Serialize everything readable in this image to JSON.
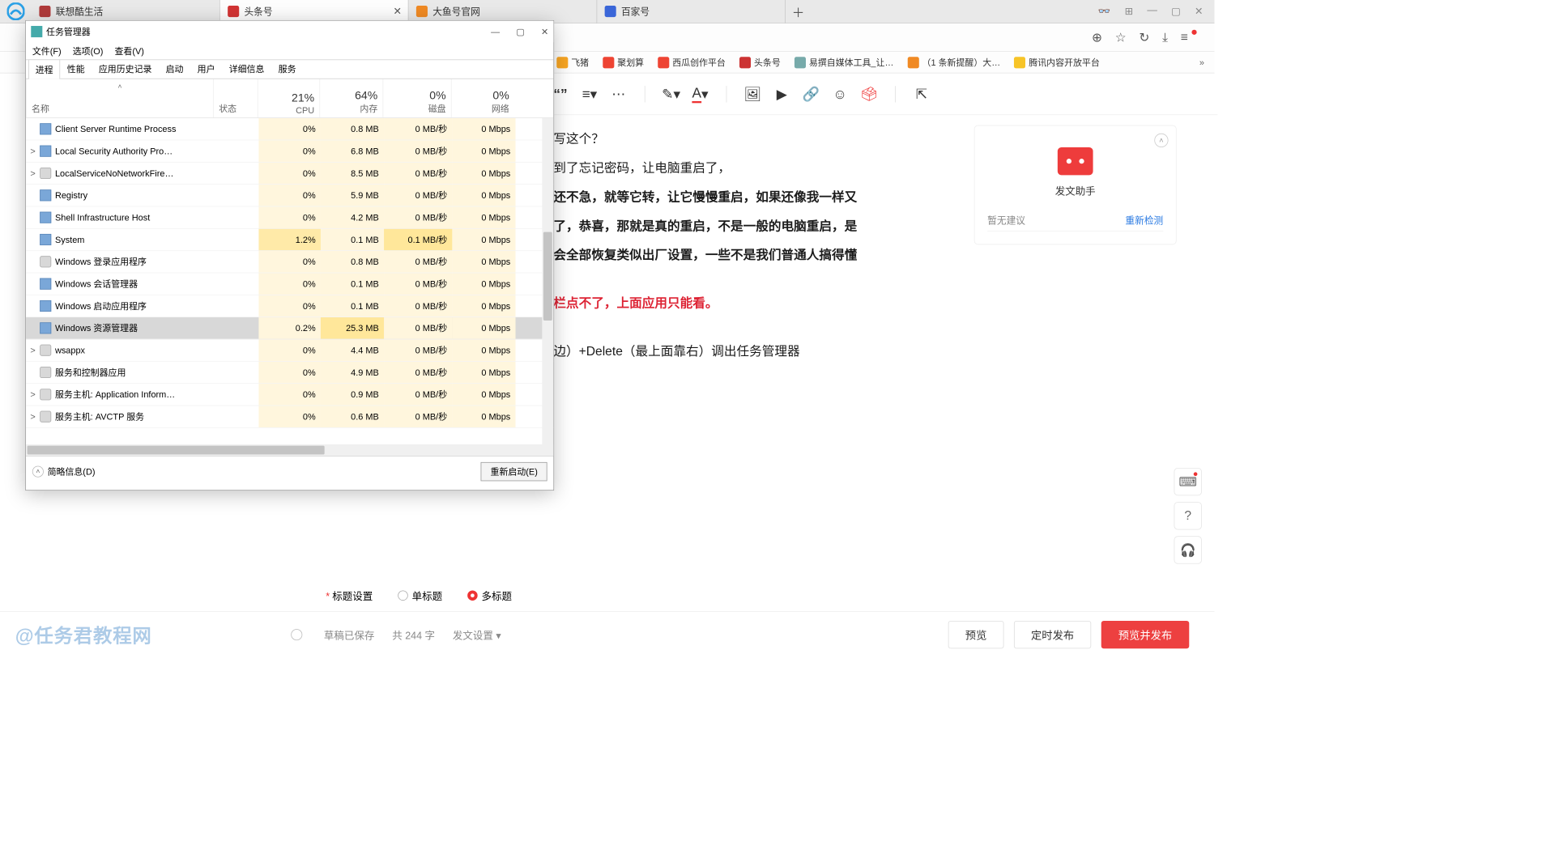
{
  "browser": {
    "tabs": [
      {
        "label": "联想酷生活",
        "favcolor": "#b03a3a"
      },
      {
        "label": "头条号",
        "favcolor": "#d23434",
        "active": true
      },
      {
        "label": "大鱼号官网",
        "favcolor": "#f08a24"
      },
      {
        "label": "百家号",
        "favcolor": "#3a66d8"
      }
    ],
    "bookmarks": [
      {
        "label": "飞猪",
        "color": "#f7a523"
      },
      {
        "label": "聚划算",
        "color": "#e43"
      },
      {
        "label": "西瓜创作平台",
        "color": "#e43"
      },
      {
        "label": "头条号",
        "color": "#c33"
      },
      {
        "label": "易撰自媒体工具_让…",
        "color": "#7aa"
      },
      {
        "label": "（1 条新提醒）大…",
        "color": "#f08a24"
      },
      {
        "label": "腾讯内容开放平台",
        "color": "#f7c427"
      }
    ]
  },
  "editor": {
    "lines": [
      {
        "text": "写这个？",
        "cls": ""
      },
      {
        "text": "到了忘记密码，让电脑重启了，",
        "cls": ""
      },
      {
        "text": "还不急，就等它转，让它慢慢重启，如果还像我一样又",
        "cls": "bold"
      },
      {
        "text": "了，恭喜，那就是真的重启，不是一般的电脑重启，是",
        "cls": "bold"
      },
      {
        "text": "会全部恢复类似出厂设置，一些不是我们普通人搞得懂",
        "cls": "bold"
      },
      {
        "text": "栏点不了，上面应用只能看。",
        "cls": "red"
      },
      {
        "text": "边）+Delete（最上面靠右）调出任务管理器",
        "cls": ""
      }
    ]
  },
  "sidebar": {
    "helper_title": "发文助手",
    "no_suggest": "暂无建议",
    "recheck": "重新检测"
  },
  "config": {
    "title_set": "标题设置",
    "single": "单标题",
    "multi": "多标题"
  },
  "footer": {
    "draft": "草稿已保存",
    "words": "共 244 字",
    "pubset": "发文设置",
    "preview": "预览",
    "schedule": "定时发布",
    "publish": "预览并发布"
  },
  "watermark": "@任务君教程网",
  "tm": {
    "title": "任务管理器",
    "menu": [
      "文件(F)",
      "选项(O)",
      "查看(V)"
    ],
    "tabs": [
      "进程",
      "性能",
      "应用历史记录",
      "启动",
      "用户",
      "详细信息",
      "服务"
    ],
    "head": {
      "name": "名称",
      "status": "状态",
      "cpu_pct": "21%",
      "cpu": "CPU",
      "mem_pct": "64%",
      "mem": "内存",
      "disk_pct": "0%",
      "disk": "磁盘",
      "net_pct": "0%",
      "net": "网络"
    },
    "rows": [
      {
        "exp": "",
        "ic": "app",
        "name": "Client Server Runtime Process",
        "cpu": "0%",
        "mem": "0.8 MB",
        "disk": "0 MB/秒",
        "net": "0 Mbps"
      },
      {
        "exp": ">",
        "ic": "app",
        "name": "Local Security Authority Pro…",
        "cpu": "0%",
        "mem": "6.8 MB",
        "disk": "0 MB/秒",
        "net": "0 Mbps"
      },
      {
        "exp": ">",
        "ic": "gear",
        "name": "LocalServiceNoNetworkFire…",
        "cpu": "0%",
        "mem": "8.5 MB",
        "disk": "0 MB/秒",
        "net": "0 Mbps"
      },
      {
        "exp": "",
        "ic": "app",
        "name": "Registry",
        "cpu": "0%",
        "mem": "5.9 MB",
        "disk": "0 MB/秒",
        "net": "0 Mbps"
      },
      {
        "exp": "",
        "ic": "app",
        "name": "Shell Infrastructure Host",
        "cpu": "0%",
        "mem": "4.2 MB",
        "disk": "0 MB/秒",
        "net": "0 Mbps"
      },
      {
        "exp": "",
        "ic": "app",
        "name": "System",
        "cpu": "1.2%",
        "cpuhot": true,
        "mem": "0.1 MB",
        "disk": "0.1 MB/秒",
        "diskhi": true,
        "net": "0 Mbps"
      },
      {
        "exp": "",
        "ic": "gear",
        "name": "Windows 登录应用程序",
        "cpu": "0%",
        "mem": "0.8 MB",
        "disk": "0 MB/秒",
        "net": "0 Mbps"
      },
      {
        "exp": "",
        "ic": "app",
        "name": "Windows 会话管理器",
        "cpu": "0%",
        "mem": "0.1 MB",
        "disk": "0 MB/秒",
        "net": "0 Mbps"
      },
      {
        "exp": "",
        "ic": "app",
        "name": "Windows 启动应用程序",
        "cpu": "0%",
        "mem": "0.1 MB",
        "disk": "0 MB/秒",
        "net": "0 Mbps"
      },
      {
        "exp": "",
        "ic": "app",
        "name": "Windows 资源管理器",
        "cpu": "0.2%",
        "mem": "25.3 MB",
        "memhi": true,
        "disk": "0 MB/秒",
        "net": "0 Mbps",
        "sel": true
      },
      {
        "exp": ">",
        "ic": "gear",
        "name": "wsappx",
        "cpu": "0%",
        "mem": "4.4 MB",
        "disk": "0 MB/秒",
        "net": "0 Mbps"
      },
      {
        "exp": "",
        "ic": "gear",
        "name": "服务和控制器应用",
        "cpu": "0%",
        "mem": "4.9 MB",
        "disk": "0 MB/秒",
        "net": "0 Mbps"
      },
      {
        "exp": ">",
        "ic": "gear",
        "name": "服务主机: Application Inform…",
        "cpu": "0%",
        "mem": "0.9 MB",
        "disk": "0 MB/秒",
        "net": "0 Mbps"
      },
      {
        "exp": ">",
        "ic": "gear",
        "name": "服务主机: AVCTP 服务",
        "cpu": "0%",
        "mem": "0.6 MB",
        "disk": "0 MB/秒",
        "net": "0 Mbps"
      }
    ],
    "brief": "简略信息(D)",
    "restart": "重新启动(E)"
  }
}
